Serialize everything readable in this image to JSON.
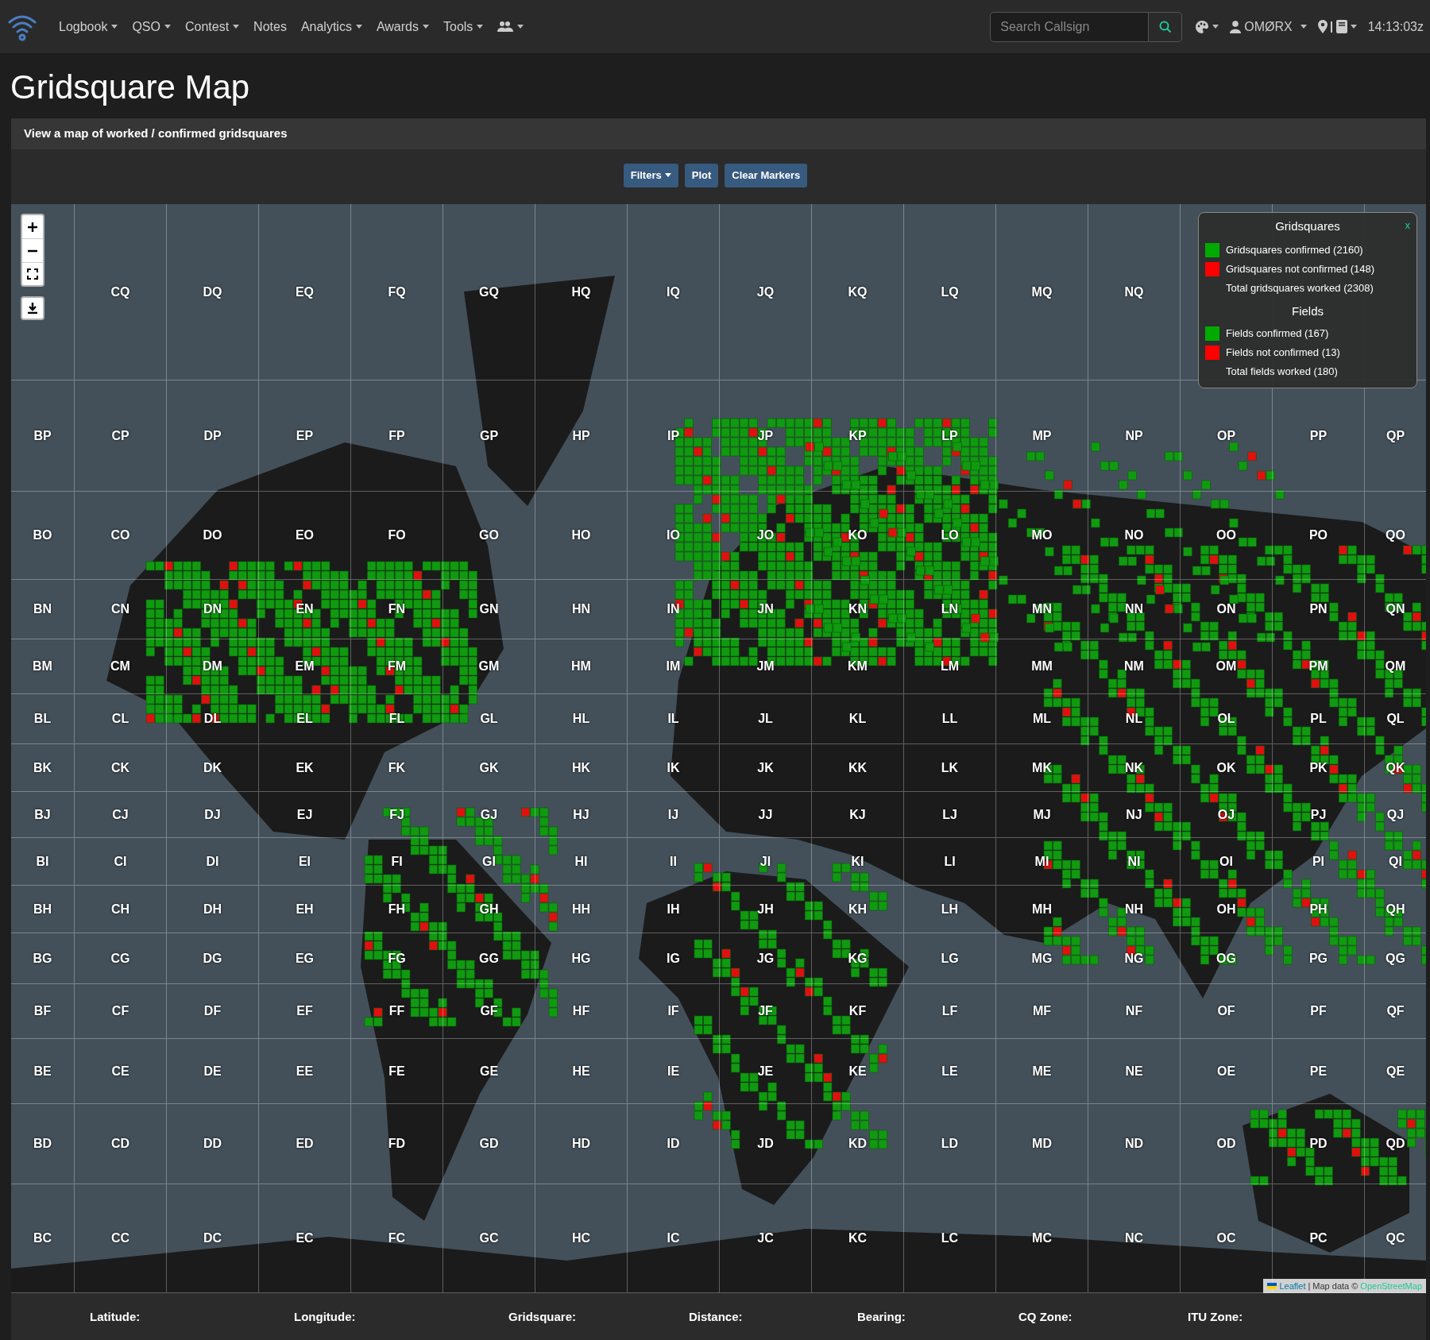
{
  "navbar": {
    "menus": [
      {
        "kind": "text",
        "label": "Logbook",
        "dropdown": true
      },
      {
        "kind": "text",
        "label": "QSO",
        "dropdown": true
      },
      {
        "kind": "text",
        "label": "Contest",
        "dropdown": true
      },
      {
        "kind": "text",
        "label": "Notes",
        "dropdown": false
      },
      {
        "kind": "text",
        "label": "Analytics",
        "dropdown": true
      },
      {
        "kind": "text",
        "label": "Awards",
        "dropdown": true
      },
      {
        "kind": "text",
        "label": "Tools",
        "dropdown": true
      },
      {
        "kind": "icon",
        "dropdown": true
      }
    ],
    "search": {
      "placeholder": "Search Callsign"
    },
    "user": "OMØRX",
    "clock": "14:13:03z"
  },
  "page": {
    "title": "Gridsquare Map",
    "subtitle": "View a map of worked / confirmed gridsquares"
  },
  "buttons": [
    {
      "label": "Filters",
      "dropdown": true
    },
    {
      "label": "Plot",
      "dropdown": false
    },
    {
      "label": "Clear Markers",
      "dropdown": false
    }
  ],
  "map": {
    "grid_rows": [
      [
        null,
        "CQ",
        "DQ",
        "EQ",
        "FQ",
        "GQ",
        "HQ",
        "IQ",
        "JQ",
        "KQ",
        "LQ",
        "MQ",
        "NQ",
        null,
        null,
        null
      ],
      [
        "BP",
        "CP",
        "DP",
        "EP",
        "FP",
        "GP",
        "HP",
        "IP",
        "JP",
        "KP",
        "LP",
        "MP",
        "NP",
        "OP",
        "PP",
        "QP"
      ],
      [
        "BO",
        "CO",
        "DO",
        "EO",
        "FO",
        "GO",
        "HO",
        "IO",
        "JO",
        "KO",
        "LO",
        "MO",
        "NO",
        "OO",
        "PO",
        "QO"
      ],
      [
        "BN",
        "CN",
        "DN",
        "EN",
        "FN",
        "GN",
        "HN",
        "IN",
        "JN",
        "KN",
        "LN",
        "MN",
        "NN",
        "ON",
        "PN",
        "QN"
      ],
      [
        "BM",
        "CM",
        "DM",
        "EM",
        "FM",
        "GM",
        "HM",
        "IM",
        "JM",
        "KM",
        "LM",
        "MM",
        "NM",
        "OM",
        "PM",
        "QM"
      ],
      [
        "BL",
        "CL",
        "DL",
        "EL",
        "FL",
        "GL",
        "HL",
        "IL",
        "JL",
        "KL",
        "LL",
        "ML",
        "NL",
        "OL",
        "PL",
        "QL"
      ],
      [
        "BK",
        "CK",
        "DK",
        "EK",
        "FK",
        "GK",
        "HK",
        "IK",
        "JK",
        "KK",
        "LK",
        "MK",
        "NK",
        "OK",
        "PK",
        "QK"
      ],
      [
        "BJ",
        "CJ",
        "DJ",
        "EJ",
        "FJ",
        "GJ",
        "HJ",
        "IJ",
        "JJ",
        "KJ",
        "LJ",
        "MJ",
        "NJ",
        "OJ",
        "PJ",
        "QJ"
      ],
      [
        "BI",
        "CI",
        "DI",
        "EI",
        "FI",
        "GI",
        "HI",
        "II",
        "JI",
        "KI",
        "LI",
        "MI",
        "NI",
        "OI",
        "PI",
        "QI"
      ],
      [
        "BH",
        "CH",
        "DH",
        "EH",
        "FH",
        "GH",
        "HH",
        "IH",
        "JH",
        "KH",
        "LH",
        "MH",
        "NH",
        "OH",
        "PH",
        "QH"
      ],
      [
        "BG",
        "CG",
        "DG",
        "EG",
        "FG",
        "GG",
        "HG",
        "IG",
        "JG",
        "KG",
        "LG",
        "MG",
        "NG",
        "OG",
        "PG",
        "QG"
      ],
      [
        "BF",
        "CF",
        "DF",
        "EF",
        "FF",
        "GF",
        "HF",
        "IF",
        "JF",
        "KF",
        "LF",
        "MF",
        "NF",
        "OF",
        "PF",
        "QF"
      ],
      [
        "BE",
        "CE",
        "DE",
        "EE",
        "FE",
        "GE",
        "HE",
        "IE",
        "JE",
        "KE",
        "LE",
        "ME",
        "NE",
        "OE",
        "PE",
        "QE"
      ],
      [
        "BD",
        "CD",
        "DD",
        "ED",
        "FD",
        "GD",
        "HD",
        "ID",
        "JD",
        "KD",
        "LD",
        "MD",
        "ND",
        "OD",
        "PD",
        "QD"
      ],
      [
        "BC",
        "CC",
        "DC",
        "EC",
        "FC",
        "GC",
        "HC",
        "IC",
        "JC",
        "KC",
        "LC",
        "MC",
        "NC",
        "OC",
        "PC",
        "QC"
      ]
    ],
    "legend": {
      "title": "Gridsquares",
      "close": "x",
      "sections": [
        {
          "kind": "swatch",
          "color": "#00aa00",
          "text": "Gridsquares confirmed (2160)"
        },
        {
          "kind": "swatch",
          "color": "#ff0000",
          "text": "Gridsquares not confirmed (148)"
        },
        {
          "kind": "plain",
          "text": "Total gridsquares worked (2308)"
        },
        {
          "kind": "heading",
          "text": "Fields"
        },
        {
          "kind": "swatch",
          "color": "#00aa00",
          "text": "Fields confirmed (167)"
        },
        {
          "kind": "swatch",
          "color": "#ff0000",
          "text": "Fields not confirmed (13)"
        },
        {
          "kind": "plain",
          "text": "Total fields worked (180)"
        }
      ]
    },
    "attribution": {
      "leaflet": "Leaflet",
      "separator": "|",
      "text": "Map data ©",
      "link": "OpenStreetMap"
    }
  },
  "info_bar": [
    "Latitude:",
    "Longitude:",
    "Gridsquare:",
    "Distance:",
    "Bearing:",
    "CQ Zone:",
    "ITU Zone:"
  ]
}
